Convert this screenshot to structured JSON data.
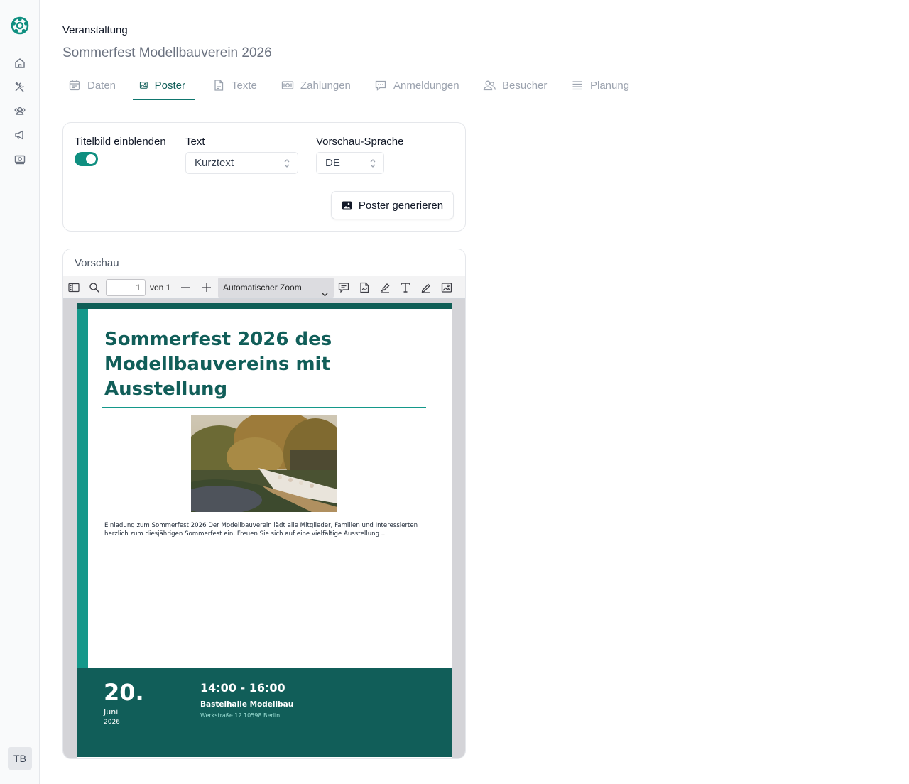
{
  "sidebar": {
    "logo_icon": "brand-logo-icon",
    "items": [
      {
        "icon": "home-icon"
      },
      {
        "icon": "tools-icon"
      },
      {
        "icon": "group-icon"
      },
      {
        "icon": "megaphone-icon"
      },
      {
        "icon": "money-icon"
      }
    ],
    "avatar": "TB"
  },
  "header": {
    "section": "Veranstaltung",
    "title": "Sommerfest Modellbauverein 2026"
  },
  "tabs": [
    {
      "label": "Daten",
      "icon": "calendar-icon",
      "active": false
    },
    {
      "label": "Poster",
      "icon": "image-icon",
      "active": true
    },
    {
      "label": "Texte",
      "icon": "document-icon",
      "active": false
    },
    {
      "label": "Zahlungen",
      "icon": "banknote-icon",
      "active": false
    },
    {
      "label": "Anmeldungen",
      "icon": "chat-icon",
      "active": false
    },
    {
      "label": "Besucher",
      "icon": "users-icon",
      "active": false
    },
    {
      "label": "Planung",
      "icon": "list-icon",
      "active": false
    }
  ],
  "settings": {
    "show_cover_label": "Titelbild einblenden",
    "show_cover_value": true,
    "text_label": "Text",
    "text_value": "Kurztext",
    "language_label": "Vorschau-Sprache",
    "language_value": "DE",
    "generate_button": "Poster generieren"
  },
  "preview": {
    "title": "Vorschau",
    "toolbar": {
      "page_value": "1",
      "page_of": "von 1",
      "zoom_value": "Automatischer Zoom"
    },
    "poster": {
      "title": "Sommerfest 2026 des Modellbauvereins mit Ausstellung",
      "body": "Einladung zum Sommerfest 2026 Der Modellbauverein lädt alle Mitglieder, Familien und Interessierten herzlich zum diesjährigen Sommerfest ein.  Freuen Sie sich auf eine vielfältige Ausstellung ..",
      "day": "20.",
      "month": "Juni",
      "year": "2026",
      "time": "14:00 - 16:00",
      "venue": "Bastelhalle Modellbau",
      "address": "Werkstraße 12 10598 Berlin"
    }
  },
  "colors": {
    "accent": "#0f766e",
    "poster_dark": "#115e59",
    "poster_bar": "#14988a"
  }
}
